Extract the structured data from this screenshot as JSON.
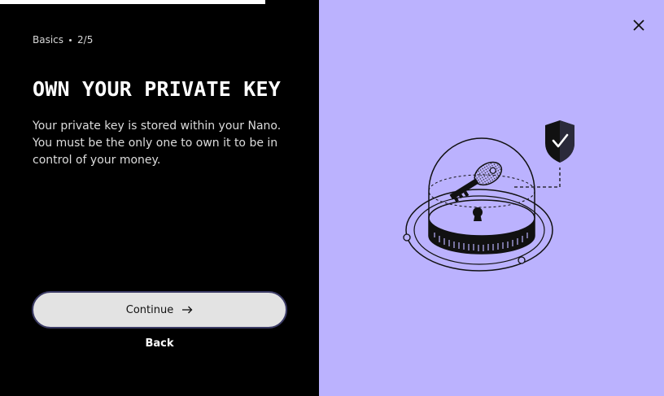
{
  "progress": {
    "fraction": 0.4
  },
  "breadcrumb": {
    "section": "Basics",
    "step": "2/5"
  },
  "title": "OWN YOUR PRIVATE KEY",
  "description": "Your private key is stored within your Nano. You must be the only one to own it to be in control of your money.",
  "buttons": {
    "continue_label": "Continue",
    "continue_icon": "arrow-right-icon",
    "back_label": "Back",
    "close_icon": "close-icon"
  },
  "illustration": {
    "name": "private-key-dome-illustration"
  },
  "colors": {
    "left_bg": "#000000",
    "right_bg": "#bbb2fe",
    "button_bg": "#e3e3e3",
    "button_border": "#3c3c66"
  }
}
